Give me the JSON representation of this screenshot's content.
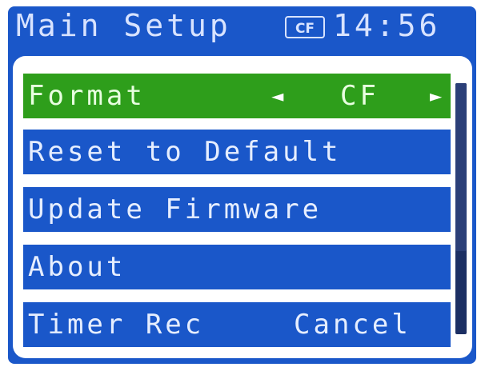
{
  "header": {
    "title": "Main Setup",
    "media_badge": "CF",
    "clock": "14:56"
  },
  "menu": {
    "items": [
      {
        "label": "Format",
        "value": "CF",
        "selected": true
      },
      {
        "label": "Reset to Default",
        "value": ""
      },
      {
        "label": "Update Firmware",
        "value": ""
      },
      {
        "label": "About",
        "value": ""
      },
      {
        "label": "Timer Rec",
        "value": "Cancel"
      }
    ]
  },
  "scrollbar": {
    "position_fraction": 0.0,
    "visible_fraction": 0.67
  },
  "colors": {
    "background_blue": "#1a57c9",
    "selected_green": "#2e9e1b",
    "panel_white": "#ffffff",
    "scrollbar_track": "#1c2f63"
  },
  "icons": {
    "left_arrow": "triangle-left-icon",
    "right_arrow": "triangle-right-icon"
  }
}
